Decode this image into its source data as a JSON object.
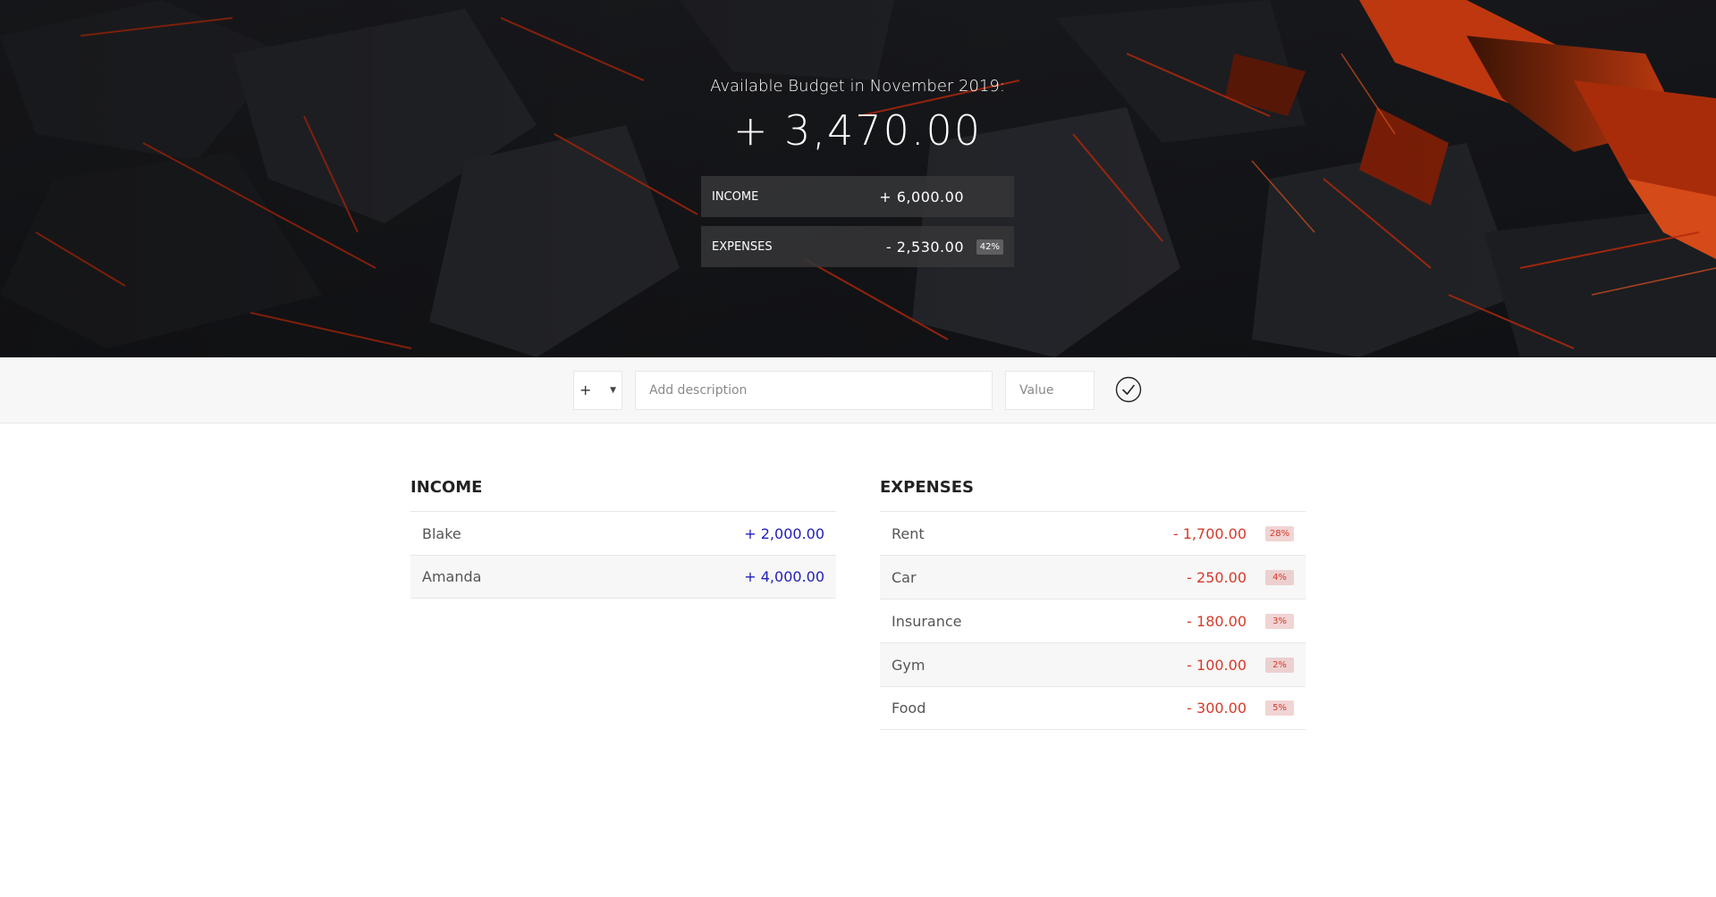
{
  "header": {
    "budget_title": "Available Budget in November 2019:",
    "budget_value": "+ 3,470.00",
    "income": {
      "label": "Income",
      "value": "+ 6,000.00"
    },
    "expenses": {
      "label": "Expenses",
      "value": "- 2,530.00",
      "percentage": "42%"
    }
  },
  "add_form": {
    "type_value": "+",
    "description_placeholder": "Add description",
    "value_placeholder": "Value",
    "submit_icon": "check-circle-icon"
  },
  "income_list": {
    "title": "Income",
    "items": [
      {
        "description": "Blake",
        "value": "+ 2,000.00"
      },
      {
        "description": "Amanda",
        "value": "+ 4,000.00"
      }
    ]
  },
  "expenses_list": {
    "title": "Expenses",
    "items": [
      {
        "description": "Rent",
        "value": "- 1,700.00",
        "percentage": "28%"
      },
      {
        "description": "Car",
        "value": "- 250.00",
        "percentage": "4%"
      },
      {
        "description": "Insurance",
        "value": "- 180.00",
        "percentage": "3%"
      },
      {
        "description": "Gym",
        "value": "- 100.00",
        "percentage": "2%"
      },
      {
        "description": "Food",
        "value": "- 300.00",
        "percentage": "5%"
      }
    ]
  },
  "colors": {
    "income_accent": "#2320b8",
    "expense_accent": "#d63a2a",
    "hero_background": "#16171a"
  }
}
